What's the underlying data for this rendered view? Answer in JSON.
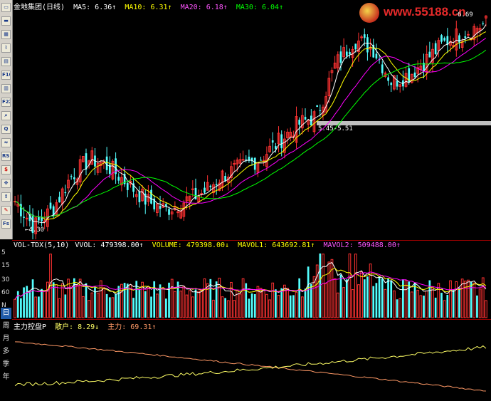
{
  "price_header": {
    "title": "金地集团(日线)",
    "ma5": "MA5: 6.36↑",
    "ma10": "MA10: 6.31↑",
    "ma20": "MA20: 6.18↑",
    "ma30": "MA30: 6.04↑"
  },
  "price_notes": {
    "high": "6.69",
    "low": "←4.30",
    "band": "5.45-5.51"
  },
  "vol_header": {
    "name": "VOL-TDX(5,10)",
    "vvol": "VVOL: 479398.00↑",
    "volume": "VOLUME: 479398.00↓",
    "mavol1": "MAVOL1: 643692.81↑",
    "mavol2": "MAVOL2: 509488.00↑"
  },
  "ind_header": {
    "name": "主力控盘P",
    "retail": "散户: 8.29↓",
    "main": "主力: 69.31↑"
  },
  "watermark": {
    "text": "www.55188.cn"
  },
  "toolbar": {
    "items": [
      "▭",
      "▬",
      "▦",
      "⌇",
      "▤",
      "F10",
      "▥",
      "F2Z",
      "⌕",
      "Q",
      "≈",
      "RSI",
      "$",
      "✥",
      "↕",
      "✎",
      "Fs"
    ]
  },
  "periods": {
    "items": [
      "日",
      "周",
      "月",
      "多",
      "季",
      "年"
    ]
  },
  "left_labels": [
    "5",
    "15",
    "30",
    "60",
    "N"
  ],
  "colors": {
    "up": "#ff3232",
    "down": "#54ffff",
    "ma5": "#ffffff",
    "ma10": "#ffff00",
    "ma20": "#ff00ff",
    "ma30": "#00ff00",
    "retail": "#ffff66",
    "main": "#ff9966"
  },
  "chart_data": {
    "type": "line",
    "ohlc_approx": [
      4.6,
      4.3,
      4.5,
      4.9,
      5.1,
      5.0,
      4.8,
      4.6,
      4.5,
      4.6,
      4.7,
      4.9,
      5.0,
      5.1,
      5.3,
      5.5,
      5.6,
      6.2,
      6.5,
      6.4,
      6.0,
      6.1,
      6.3,
      6.5,
      6.6,
      6.69
    ],
    "ma_values": {
      "MA5": 6.36,
      "MA10": 6.31,
      "MA20": 6.18,
      "MA30": 6.04
    },
    "volume": {
      "VVOL": 479398.0,
      "VOLUME": 479398.0,
      "MAVOL1": 643692.81,
      "MAVOL2": 509488.0
    },
    "indicator": {
      "散户": 8.29,
      "主力": 69.31
    }
  }
}
